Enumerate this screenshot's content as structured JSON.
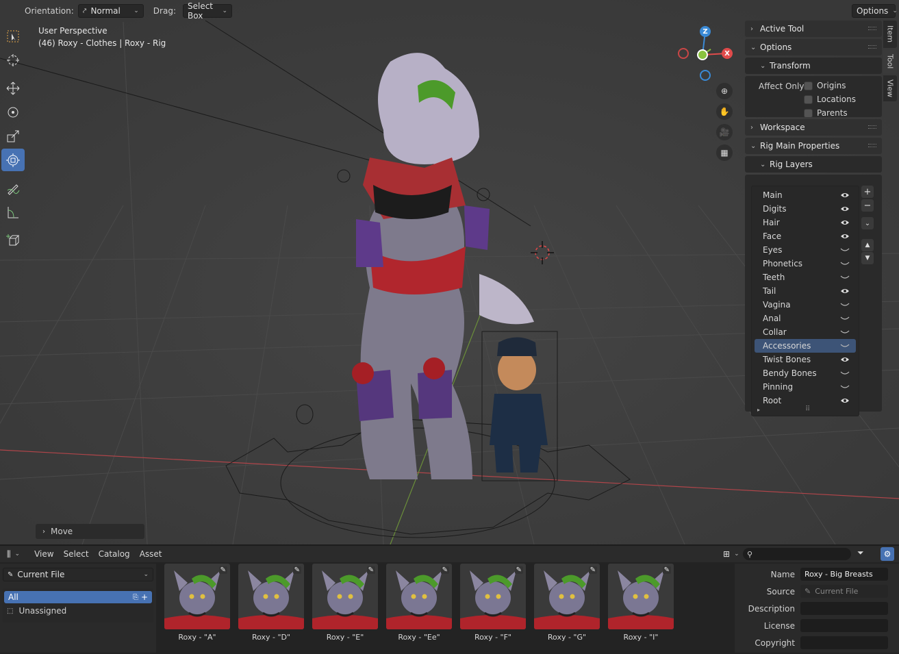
{
  "header": {
    "orientation_label": "Orientation:",
    "orientation_value": "Normal",
    "drag_label": "Drag:",
    "drag_value": "Select Box",
    "options_label": "Options"
  },
  "viewport": {
    "perspective": "User Perspective",
    "object_info": "(46) Roxy - Clothes | Roxy - Rig",
    "gizmo": {
      "z": "Z",
      "x": "X"
    },
    "last_operator": "Move"
  },
  "toolbar": {
    "tools": [
      "select-box",
      "cursor",
      "move",
      "rotate",
      "scale",
      "transform",
      "annotate",
      "measure",
      "add-cube"
    ],
    "active": "transform"
  },
  "npanel": {
    "tabs": [
      "Item",
      "Tool",
      "View"
    ],
    "active_tab": "Tool",
    "active_tool": "Active Tool",
    "options": "Options",
    "transform": "Transform",
    "affect_only": "Affect Only",
    "affect_items": [
      "Origins",
      "Locations",
      "Parents"
    ],
    "workspace": "Workspace",
    "rig_main": "Rig Main Properties",
    "rig_layers": "Rig Layers",
    "layers": [
      {
        "name": "Main",
        "visible": true
      },
      {
        "name": "Digits",
        "visible": true
      },
      {
        "name": "Hair",
        "visible": true
      },
      {
        "name": "Face",
        "visible": true
      },
      {
        "name": "Eyes",
        "visible": false
      },
      {
        "name": "Phonetics",
        "visible": false
      },
      {
        "name": "Teeth",
        "visible": false
      },
      {
        "name": "Tail",
        "visible": true
      },
      {
        "name": "Vagina",
        "visible": false
      },
      {
        "name": "Anal",
        "visible": false
      },
      {
        "name": "Collar",
        "visible": false
      },
      {
        "name": "Accessories",
        "visible": false,
        "selected": true
      },
      {
        "name": "Twist Bones",
        "visible": true
      },
      {
        "name": "Bendy Bones",
        "visible": false
      },
      {
        "name": "Pinning",
        "visible": false
      },
      {
        "name": "Root",
        "visible": true
      }
    ]
  },
  "asset_browser": {
    "menus": [
      "View",
      "Select",
      "Catalog",
      "Asset"
    ],
    "library": "Current File",
    "catalogs": [
      "All",
      "Unassigned"
    ],
    "assets": [
      "Roxy -  \"A\"",
      "Roxy - \"D\"",
      "Roxy - \"E\"",
      "Roxy - \"Ee\"",
      "Roxy - \"F\"",
      "Roxy - \"G\"",
      "Roxy - \"I\""
    ],
    "props": {
      "name_label": "Name",
      "name_value": "Roxy - Big Breasts",
      "source_label": "Source",
      "source_value": "Current File",
      "description_label": "Description",
      "license_label": "License",
      "copyright_label": "Copyright"
    }
  },
  "colors": {
    "accent": "#4772b3",
    "axis_x": "#e04b4b",
    "axis_y": "#8ac33f",
    "axis_z": "#3a8ad6"
  }
}
